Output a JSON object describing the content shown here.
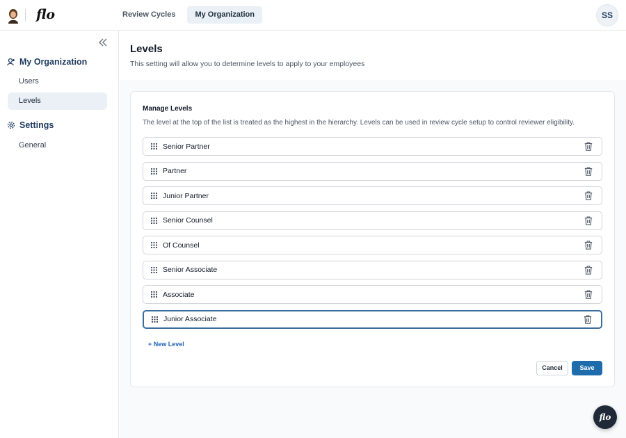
{
  "app": {
    "brand": "flo",
    "user_initials": "SS"
  },
  "topnav": {
    "tabs": [
      {
        "label": "Review Cycles"
      },
      {
        "label": "My Organization"
      }
    ]
  },
  "sidebar": {
    "sections": [
      {
        "label": "My Organization",
        "icon": "user-icon",
        "items": [
          {
            "label": "Users"
          },
          {
            "label": "Levels"
          }
        ]
      },
      {
        "label": "Settings",
        "icon": "gear-icon",
        "items": [
          {
            "label": "General"
          }
        ]
      }
    ]
  },
  "page": {
    "title": "Levels",
    "subtitle": "This setting will allow you to determine levels to apply to your employees"
  },
  "manage_levels": {
    "title": "Manage Levels",
    "description": "The level at the top of the list is treated as the highest in the hierarchy. Levels can be used in review cycle setup to control reviewer eligibility.",
    "levels": [
      "Senior Partner",
      "Partner",
      "Junior Partner",
      "Senior Counsel",
      "Of Counsel",
      "Senior Associate",
      "Associate",
      "Junior Associate"
    ],
    "new_level_label": "+ New Level",
    "cancel_label": "Cancel",
    "save_label": "Save"
  },
  "chat": {
    "label": "flo"
  },
  "colors": {
    "accent": "#1f6cad",
    "nav_text": "#1e3a5f",
    "active_bg": "#eaf0f6"
  }
}
